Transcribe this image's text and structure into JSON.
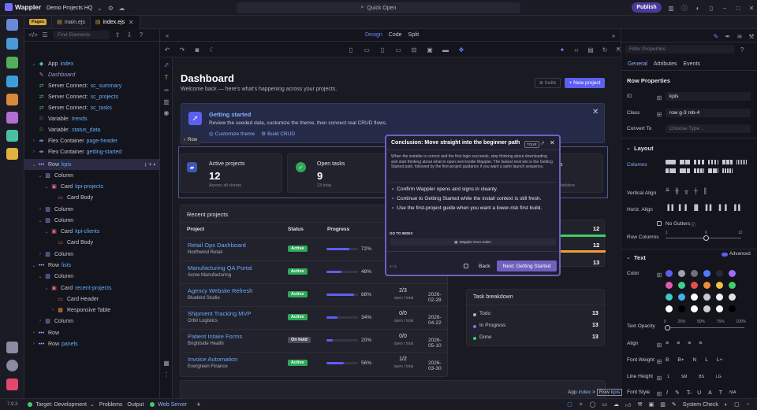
{
  "app": {
    "name": "Wappler",
    "project": "Demo Projects HQ",
    "quick_open": "Quick Open",
    "publish": "Publish"
  },
  "tabs": {
    "pages_badge": "Pages",
    "items": [
      {
        "label": "main.ejs"
      },
      {
        "label": "index.ejs"
      }
    ]
  },
  "tree": {
    "find_placeholder": "Find Elements",
    "nodes": [
      {
        "label": "App",
        "sub": "index"
      },
      {
        "label": "Dashboard"
      },
      {
        "label": "Server Connect:",
        "sub": "sc_summary"
      },
      {
        "label": "Server Connect:",
        "sub": "sc_projects"
      },
      {
        "label": "Server Connect:",
        "sub": "sc_tasks"
      },
      {
        "label": "Variable:",
        "sub": "trends"
      },
      {
        "label": "Variable:",
        "sub": "status_data"
      },
      {
        "label": "Flex Container",
        "sub": "page-header"
      },
      {
        "label": "Flex Container",
        "sub": "getting-started"
      },
      {
        "label": "Row",
        "sub": "kpis"
      },
      {
        "label": "Column"
      },
      {
        "label": "Card",
        "sub": "kpi-projects"
      },
      {
        "label": "Card Body"
      },
      {
        "label": "Column"
      },
      {
        "label": "Column"
      },
      {
        "label": "Card",
        "sub": "kpi-clients"
      },
      {
        "label": "Card Body"
      },
      {
        "label": "Column"
      },
      {
        "label": "Row",
        "sub": "lists"
      },
      {
        "label": "Column"
      },
      {
        "label": "Card",
        "sub": "recent-projects"
      },
      {
        "label": "Card Header"
      },
      {
        "label": "Responsive Table"
      },
      {
        "label": "Column"
      },
      {
        "label": "Row"
      },
      {
        "label": "Row",
        "sub": "panels"
      }
    ]
  },
  "designbar": {
    "design": "Design",
    "code": "Code",
    "split": "Split"
  },
  "canvas": {
    "title": "Dashboard",
    "subtitle": "Welcome back — here's what's happening across your projects.",
    "invite": "Invite",
    "new_project": "+ New project",
    "getting_started": {
      "title": "Getting started",
      "text": "Review the seeded data, customize the theme, then connect real CRUD flows.",
      "link1": "Customize theme",
      "link2": "Build CRUD"
    },
    "row_tag": "Row",
    "kpis": [
      {
        "label": "Active projects",
        "value": "12",
        "sub": "Across all clients"
      },
      {
        "label": "Open tasks",
        "value": "9",
        "sub": "13 total"
      }
    ],
    "kpi_partial": {
      "label": "ts",
      "sub": "holders"
    },
    "recent": {
      "title": "Recent projects",
      "headers": [
        "Project",
        "Status",
        "Progress"
      ],
      "rows": [
        {
          "name": "Retail Ops Dashboard",
          "client": "Northwind Retail",
          "status": "Active",
          "pct": "72%",
          "progress": 0.72,
          "tasks": "",
          "due": ""
        },
        {
          "name": "Manufacturing QA Portal",
          "client": "Acme Manufacturing",
          "status": "Active",
          "pct": "48%",
          "progress": 0.48,
          "tasks": "",
          "due": ""
        },
        {
          "name": "Agency Website Refresh",
          "client": "Bluebird Studio",
          "status": "Active",
          "pct": "88%",
          "progress": 0.88,
          "tasks": "2/3",
          "tasks_sub": "open / total",
          "due": "2026-02-28"
        },
        {
          "name": "Shipment Tracking MVP",
          "client": "Orbit Logistics",
          "status": "Active",
          "pct": "34%",
          "progress": 0.34,
          "tasks": "0/0",
          "tasks_sub": "open / total",
          "due": "2026-04-22"
        },
        {
          "name": "Patient Intake Forms",
          "client": "Brightside Health",
          "status": "On hold",
          "pct": "20%",
          "progress": 0.2,
          "tasks": "0/0",
          "tasks_sub": "open / total",
          "due": "2026-05-10"
        },
        {
          "name": "Invoice Automation",
          "client": "Evergreen Finance",
          "status": "Active",
          "pct": "56%",
          "progress": 0.56,
          "tasks": "1/2",
          "tasks_sub": "open / total",
          "due": "2026-03-30"
        }
      ]
    },
    "side_values": [
      "12",
      "12",
      "13"
    ],
    "breakdown": {
      "title": "Task breakdown",
      "items": [
        {
          "label": "Todo",
          "value": "13",
          "color": "#b0b0c0"
        },
        {
          "label": "In Progress",
          "value": "13",
          "color": "#5d7fff"
        },
        {
          "label": "Done",
          "value": "13",
          "color": "#3ecf6a"
        }
      ]
    }
  },
  "popover": {
    "title": "Conclusion: Move straight into the beginner path",
    "tour": "TOUR",
    "body": "When the installer is correct and the first login succeeds, stop thinking about downloading and start thinking about what to open next inside Wappler. The fastest next win is the Getting Started path, followed by the first-project guidance if you want a safer launch sequence.",
    "bullets": [
      "Confirm Wappler opens and signs in cleanly.",
      "Continue to Getting Started while the install context is still fresh.",
      "Use the first-project guide when you want a lower-risk first build."
    ],
    "goto": "GO TO INDEX",
    "docs": "Wappler Docs Index",
    "step": "4 / 4",
    "back": "Back",
    "next": "Next: Getting Started"
  },
  "right": {
    "filter_placeholder": "Filter Properties",
    "tabs": [
      "General",
      "Attributes",
      "Events"
    ],
    "row_props": "Row Properties",
    "id_label": "ID",
    "id_value": "kpis",
    "class_label": "Class",
    "class_value": "row g-3 mb-4",
    "convert_label": "Convert To",
    "convert_placeholder": "Choose Type ..",
    "layout": "Layout",
    "columns": "Columns",
    "valign": "Vertical Align",
    "halign": "Horiz. Align",
    "no_gutters": "No Gutters",
    "row_columns": "Row Columns",
    "rc_min": "1",
    "rc_mid": "6",
    "rc_max": "12",
    "text": "Text",
    "advanced": "Advanced",
    "color": "Color",
    "opacity": "Text Opacity",
    "op_ticks": [
      "0",
      "25%",
      "50%",
      "75%",
      "100%"
    ],
    "align": "Align",
    "font_weight": "Font Weight",
    "fw": [
      "B",
      "B+",
      "N",
      "L",
      "L+"
    ],
    "line_height": "Line Height",
    "lh": [
      "1",
      "SM",
      "BS",
      "LG"
    ],
    "font_style": "Font Style",
    "na": "N/A"
  },
  "breadcrumb": {
    "a": "App",
    "b": "index",
    "c": "Row",
    "d": "kpis"
  },
  "status": {
    "version": "7.9.3",
    "target": "Target: Development",
    "problems": "Problems",
    "output": "Output",
    "web_server": "Web Server",
    "system_check": "System Check"
  },
  "colors": {
    "accent": "#5d5ff0",
    "swatches": [
      "#5d5ff0",
      "#a0a0b0",
      "#707080",
      "#4f7bff",
      "#2a2a36",
      "#a06bff",
      "#e05bb0",
      "#3ecf8e",
      "#e84c4c",
      "#f08a3c",
      "#f0c040",
      "#3ecf6a",
      "#3ec9c9",
      "#40b0f0",
      "#ffffff",
      "#c8c8d4",
      "#f0f0f4",
      "#e0e0e8",
      "#ffffff",
      "#000000",
      "#ffffff",
      "#d0d0d8",
      "#ffffff",
      "#000000"
    ]
  }
}
